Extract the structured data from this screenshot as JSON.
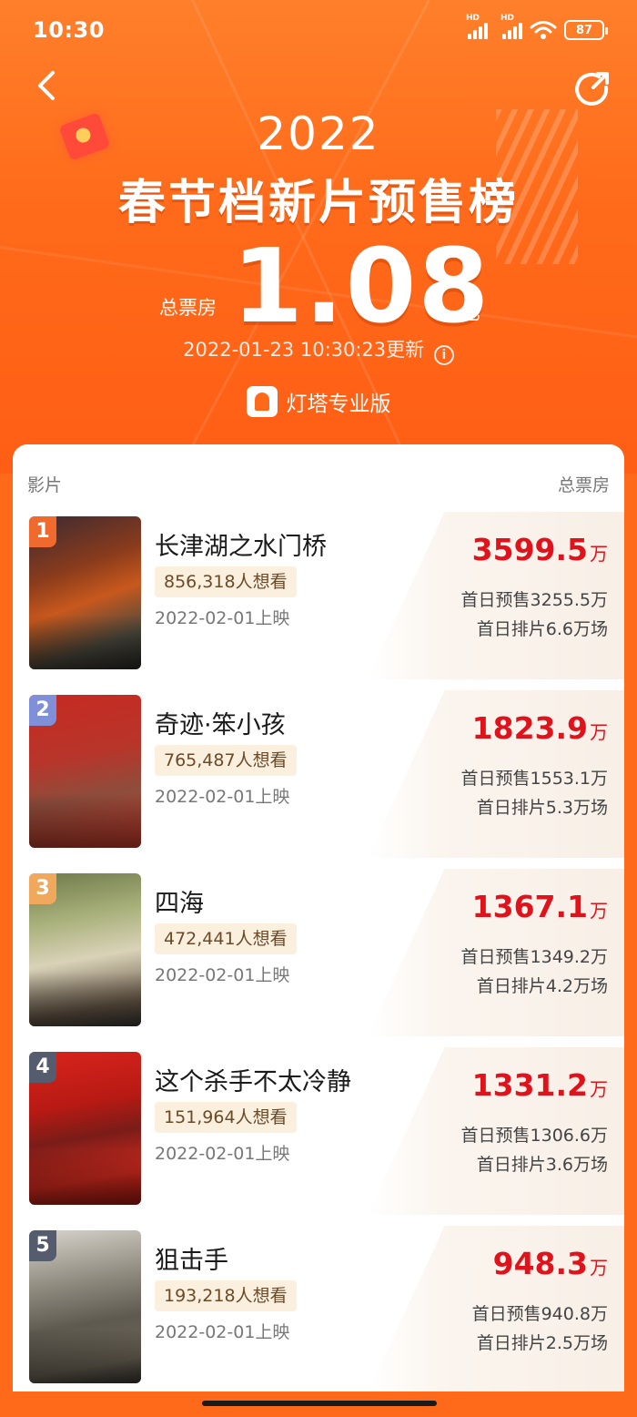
{
  "status_bar": {
    "time": "10:30",
    "signal_1_label": "HD",
    "signal_2_label": "HD",
    "battery": "87"
  },
  "header": {
    "year": "2022",
    "title": "春节档新片预售榜",
    "total_label": "总票房",
    "total_value": "1.08",
    "total_unit": "亿",
    "update_text": "2022-01-23 10:30:23更新",
    "brand": "灯塔专业版",
    "icons": {
      "back": "back-arrow-icon",
      "share": "share-icon",
      "info": "info-icon"
    }
  },
  "list": {
    "col_film": "影片",
    "col_box": "总票房",
    "films": [
      {
        "rank": "1",
        "title": "长津湖之水门桥",
        "want": "856,318人想看",
        "release": "2022-02-01上映",
        "box": "3599.5",
        "unit": "万",
        "presale": "首日预售3255.5万",
        "screens": "首日排片6.6万场"
      },
      {
        "rank": "2",
        "title": "奇迹·笨小孩",
        "want": "765,487人想看",
        "release": "2022-02-01上映",
        "box": "1823.9",
        "unit": "万",
        "presale": "首日预售1553.1万",
        "screens": "首日排片5.3万场"
      },
      {
        "rank": "3",
        "title": "四海",
        "want": "472,441人想看",
        "release": "2022-02-01上映",
        "box": "1367.1",
        "unit": "万",
        "presale": "首日预售1349.2万",
        "screens": "首日排片4.2万场"
      },
      {
        "rank": "4",
        "title": "这个杀手不太冷静",
        "want": "151,964人想看",
        "release": "2022-02-01上映",
        "box": "1331.2",
        "unit": "万",
        "presale": "首日预售1306.6万",
        "screens": "首日排片3.6万场"
      },
      {
        "rank": "5",
        "title": "狙击手",
        "want": "193,218人想看",
        "release": "2022-02-01上映",
        "box": "948.3",
        "unit": "万",
        "presale": "首日预售940.8万",
        "screens": "首日排片2.5万场"
      }
    ]
  },
  "colors": {
    "header_orange": "#ff6a1a",
    "box_red": "#e0121b",
    "want_tag_bg": "#fbf0de"
  }
}
